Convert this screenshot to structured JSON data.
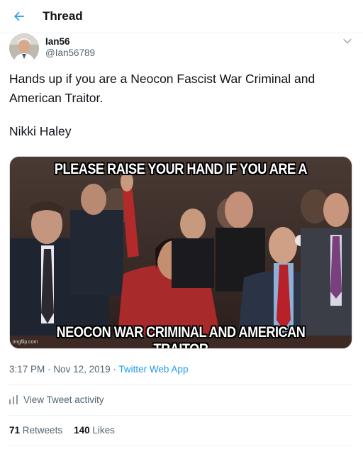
{
  "header": {
    "title": "Thread",
    "back_icon": "arrow-left-icon",
    "accent": "#1d9bf0"
  },
  "tweet": {
    "display_name": "Ian56",
    "handle": "@Ian56789",
    "text_line1": "Hands up if you are a Neocon Fascist War Criminal and",
    "text_line2": "American Traitor.",
    "signature": "Nikki Haley",
    "image": {
      "top_caption": "PLEASE RAISE YOUR HAND IF YOU ARE A",
      "bottom_caption": "NEOCON WAR CRIMINAL AND AMERICAN TRAITOR",
      "watermark": "imgflip.com"
    },
    "time": "3:17 PM",
    "date": "Nov 12, 2019",
    "separator": "·",
    "client": "Twitter Web App",
    "activity_label": "View Tweet activity",
    "retweets_count": "71",
    "retweets_label": "Retweets",
    "likes_count": "140",
    "likes_label": "Likes"
  }
}
